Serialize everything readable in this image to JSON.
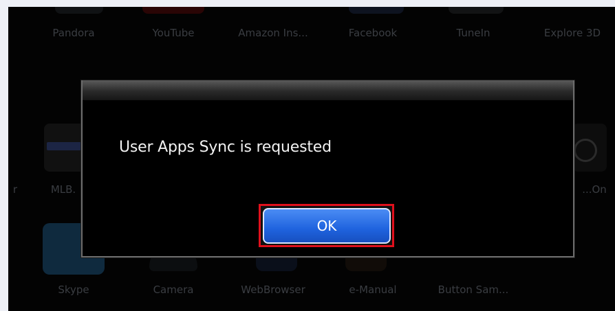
{
  "apps_row1": [
    "Pandora",
    "YouTube",
    "Amazon Ins...",
    "Facebook",
    "TuneIn",
    "Explore 3D"
  ],
  "apps_row2": [
    "r",
    "MLB.",
    "...On"
  ],
  "apps_row3": [
    "Skype",
    "Camera",
    "WebBrowser",
    "e-Manual",
    "Button Sam..."
  ],
  "dialog": {
    "message": "User Apps Sync is requested",
    "ok_label": "OK"
  },
  "colors": {
    "highlight": "#e0101c",
    "button": "#1f63de"
  }
}
